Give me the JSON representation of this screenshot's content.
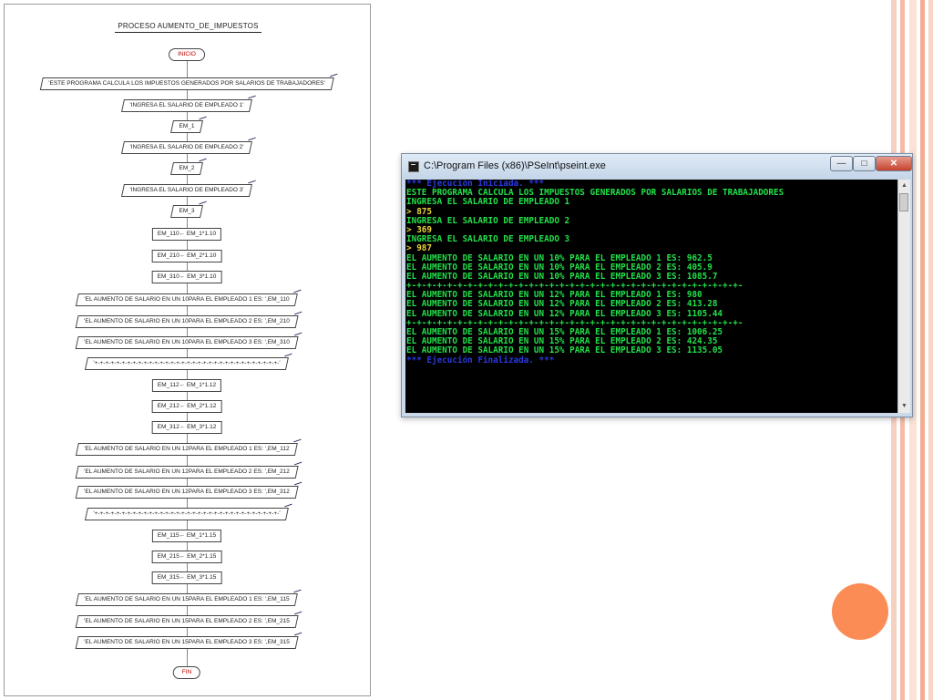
{
  "flowchart": {
    "title": "PROCESO AUMENTO_DE_IMPUESTOS",
    "nodes": [
      {
        "type": "term",
        "text": "INICIO"
      },
      {
        "type": "io",
        "text": "'ESTE PROGRAMA CALCULA LOS IMPUESTOS GENERADOS POR SALARIOS DE TRABAJADORES'"
      },
      {
        "type": "io",
        "text": "'INGRESA EL SALARIO DE EMPLEADO 1'"
      },
      {
        "type": "io",
        "text": "EM_1"
      },
      {
        "type": "io",
        "text": "'INGRESA EL SALARIO DE EMPLEADO 2'"
      },
      {
        "type": "io",
        "text": "EM_2"
      },
      {
        "type": "io",
        "text": "'INGRESA EL SALARIO DE EMPLEADO 3'"
      },
      {
        "type": "io",
        "text": "EM_3"
      },
      {
        "type": "proc",
        "text": "EM_110← EM_1*1.10"
      },
      {
        "type": "proc",
        "text": "EM_210← EM_2*1.10"
      },
      {
        "type": "proc",
        "text": "EM_310← EM_3*1.10"
      },
      {
        "type": "io",
        "text": "'EL AUMENTO DE SALARIO EN UN 10PARA EL EMPLEADO 1 ES: ',EM_110"
      },
      {
        "type": "io",
        "text": "'EL AUMENTO DE SALARIO EN UN 10PARA EL EMPLEADO 2 ES: ',EM_210"
      },
      {
        "type": "io",
        "text": "'EL AUMENTO DE SALARIO EN UN 10PARA EL EMPLEADO 3 ES: ',EM_310"
      },
      {
        "type": "io",
        "text": "'+-+-+-+-+-+-+-+-+-+-+-+-+-+-+-+-+-+-+-+-+-+-+-+-+-+-+-+-+-+-+-+-+-+-'"
      },
      {
        "type": "proc",
        "text": "EM_112← EM_1*1.12"
      },
      {
        "type": "proc",
        "text": "EM_212← EM_2*1.12"
      },
      {
        "type": "proc",
        "text": "EM_312← EM_3*1.12"
      },
      {
        "type": "io",
        "text": "'EL AUMENTO DE SALARIO EN UN 12PARA EL EMPLEADO 1 ES: ',EM_112"
      },
      {
        "type": "io",
        "text": "'EL AUMENTO DE SALARIO EN UN 12PARA EL EMPLEADO 2 ES: ',EM_212"
      },
      {
        "type": "io",
        "text": "'EL AUMENTO DE SALARIO EN UN 12PARA EL EMPLEADO 3 ES: ',EM_312"
      },
      {
        "type": "io",
        "text": "'+-+-+-+-+-+-+-+-+-+-+-+-+-+-+-+-+-+-+-+-+-+-+-+-+-+-+-+-+-+-+-+-+-+-'"
      },
      {
        "type": "proc",
        "text": "EM_115← EM_1*1.15"
      },
      {
        "type": "proc",
        "text": "EM_215← EM_2*1.15"
      },
      {
        "type": "proc",
        "text": "EM_315← EM_3*1.15"
      },
      {
        "type": "io",
        "text": "'EL AUMENTO DE SALARIO EN UN 15PARA EL EMPLEADO 1 ES: ',EM_115"
      },
      {
        "type": "io",
        "text": "'EL AUMENTO DE SALARIO EN UN 15PARA EL EMPLEADO 2 ES: ',EM_215"
      },
      {
        "type": "io",
        "text": "'EL AUMENTO DE SALARIO EN UN 15PARA EL EMPLEADO 3 ES: ',EM_315"
      },
      {
        "type": "term",
        "text": "FIN"
      }
    ]
  },
  "console_window": {
    "title": "C:\\Program Files (x86)\\PSeInt\\pseint.exe",
    "buttons": {
      "minimize": "—",
      "maximize": "□",
      "close": "✕"
    },
    "lines": [
      {
        "text": "*** Ejecución Iniciada. ***",
        "color": "#2b39e0"
      },
      {
        "text": "ESTE PROGRAMA CALCULA LOS IMPUESTOS GENERADOS POR SALARIOS DE TRABAJADORES",
        "color": "#22e04a"
      },
      {
        "text": "INGRESA EL SALARIO DE EMPLEADO 1",
        "color": "#22e04a"
      },
      {
        "text": "> 875",
        "color": "#e8d23a"
      },
      {
        "text": "INGRESA EL SALARIO DE EMPLEADO 2",
        "color": "#22e04a"
      },
      {
        "text": "> 369",
        "color": "#e8d23a"
      },
      {
        "text": "INGRESA EL SALARIO DE EMPLEADO 3",
        "color": "#22e04a"
      },
      {
        "text": "> 987",
        "color": "#e8d23a"
      },
      {
        "text": "EL AUMENTO DE SALARIO EN UN 10% PARA EL EMPLEADO 1 ES: 962.5",
        "color": "#22e04a"
      },
      {
        "text": "EL AUMENTO DE SALARIO EN UN 10% PARA EL EMPLEADO 2 ES: 405.9",
        "color": "#22e04a"
      },
      {
        "text": "EL AUMENTO DE SALARIO EN UN 10% PARA EL EMPLEADO 3 ES: 1085.7",
        "color": "#22e04a"
      },
      {
        "text": "+-+-+-+-+-+-+-+-+-+-+-+-+-+-+-+-+-+-+-+-+-+-+-+-+-+-+-+-+-+-+-+-+-",
        "color": "#22e04a"
      },
      {
        "text": "EL AUMENTO DE SALARIO EN UN 12% PARA EL EMPLEADO 1 ES: 980",
        "color": "#22e04a"
      },
      {
        "text": "EL AUMENTO DE SALARIO EN UN 12% PARA EL EMPLEADO 2 ES: 413.28",
        "color": "#22e04a"
      },
      {
        "text": "EL AUMENTO DE SALARIO EN UN 12% PARA EL EMPLEADO 3 ES: 1105.44",
        "color": "#22e04a"
      },
      {
        "text": "+-+-+-+-+-+-+-+-+-+-+-+-+-+-+-+-+-+-+-+-+-+-+-+-+-+-+-+-+-+-+-+-+-",
        "color": "#22e04a"
      },
      {
        "text": "EL AUMENTO DE SALARIO EN UN 15% PARA EL EMPLEADO 1 ES: 1006.25",
        "color": "#22e04a"
      },
      {
        "text": "EL AUMENTO DE SALARIO EN UN 15% PARA EL EMPLEADO 2 ES: 424.35",
        "color": "#22e04a"
      },
      {
        "text": "EL AUMENTO DE SALARIO EN UN 15% PARA EL EMPLEADO 3 ES: 1135.05",
        "color": "#22e04a"
      },
      {
        "text": "*** Ejecución Finalizada. ***",
        "color": "#2b39e0"
      }
    ]
  },
  "theme": {
    "accent_orange": "#fb8c55",
    "stripe_colors": [
      "#f7c7b4",
      "#fbe3d8",
      "#f6b59b"
    ]
  }
}
